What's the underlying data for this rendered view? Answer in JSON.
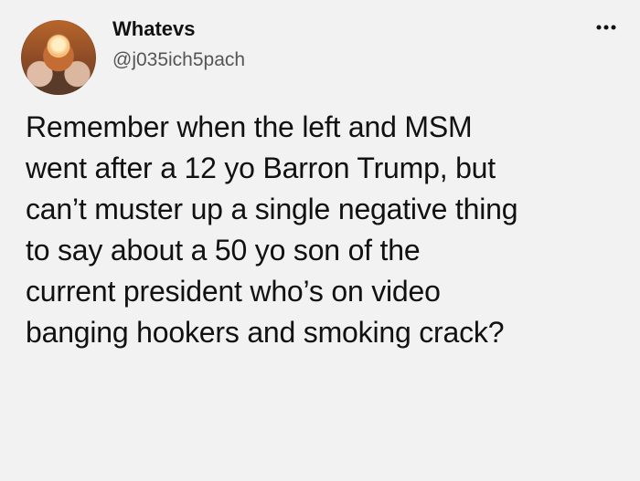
{
  "author": {
    "display_name": "Whatevs",
    "handle": "@j035ich5pach",
    "avatar_icon": "avatar-image"
  },
  "menu": {
    "more_icon": "more-options-icon"
  },
  "tweet": {
    "text": "Remember when the left and MSM\nwent after a 12 yo Barron Trump, but\ncan’t muster up a single negative thing\nto say about a 50 yo son of the\ncurrent president who’s on video\nbanging hookers and smoking crack?"
  },
  "colors": {
    "background": "#f2f2f2",
    "text": "#111111",
    "secondary_text": "#555555"
  }
}
